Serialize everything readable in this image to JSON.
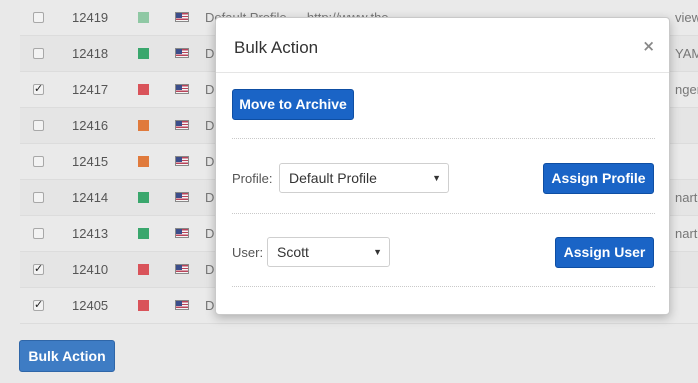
{
  "table": {
    "rows": [
      {
        "id": "12419",
        "checked": false,
        "color": "#8fc8a4",
        "text": "Default Profile — http://www.the...",
        "right": "view"
      },
      {
        "id": "12418",
        "checked": false,
        "color": "#3aa76d",
        "text": "D",
        "right": "YAMU"
      },
      {
        "id": "12417",
        "checked": true,
        "color": "#d9535a",
        "text": "D",
        "right": "nger."
      },
      {
        "id": "12416",
        "checked": false,
        "color": "#e07a3c",
        "text": "D",
        "right": ""
      },
      {
        "id": "12415",
        "checked": false,
        "color": "#e07a3c",
        "text": "D",
        "right": ""
      },
      {
        "id": "12414",
        "checked": false,
        "color": "#3aa76d",
        "text": "D",
        "right": "nartp"
      },
      {
        "id": "12413",
        "checked": false,
        "color": "#3aa76d",
        "text": "D",
        "right": "nartp"
      },
      {
        "id": "12410",
        "checked": true,
        "color": "#d9535a",
        "text": "D",
        "right": ""
      },
      {
        "id": "12405",
        "checked": true,
        "color": "#d9535a",
        "text": "D",
        "right": ""
      }
    ]
  },
  "bulk_button_label": "Bulk Action",
  "modal": {
    "title": "Bulk Action",
    "close_glyph": "×",
    "archive_label": "Move to Archive",
    "profile_label": "Profile:",
    "profile_value": "Default Profile",
    "assign_profile_label": "Assign Profile",
    "user_label": "User:",
    "user_value": "Scott",
    "assign_user_label": "Assign User",
    "caret_glyph": "▼"
  }
}
